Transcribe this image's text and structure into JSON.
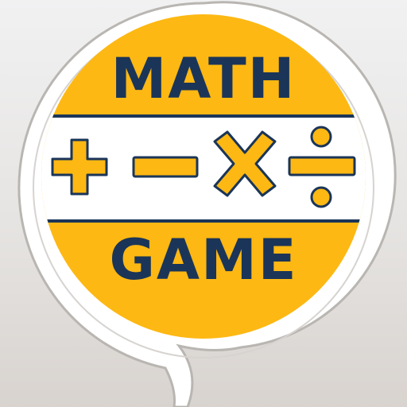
{
  "logo": {
    "title_top": "MATH",
    "title_bottom": "GAME",
    "operators": [
      "plus-icon",
      "minus-icon",
      "multiply-icon",
      "divide-icon"
    ]
  },
  "colors": {
    "badge_yellow": "#fdb813",
    "text_navy": "#1b3558",
    "band_white": "#ffffff",
    "bubble_ring": "#b9b6b2"
  }
}
